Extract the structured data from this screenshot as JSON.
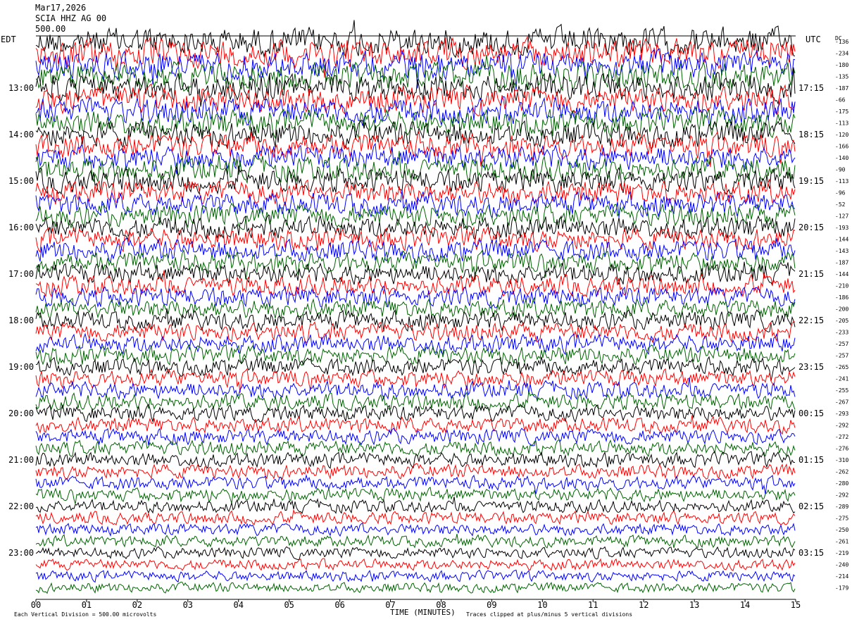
{
  "header": {
    "date": "Mar17,2026",
    "station": "SCIA HHZ AG 00",
    "scale": "500.00"
  },
  "left_zone_label": "EDT",
  "right_zone_label": "UTC",
  "dc_label": "DC",
  "footer": {
    "vertical_division": "Each Vertical Division =  500.00 microvolts",
    "xlabel": "TIME (MINUTES)",
    "clip_note": "Traces clipped at plus/minus 5 vertical divisions"
  },
  "chart_data": {
    "type": "line",
    "xlabel": "TIME (MINUTES)",
    "xlim": [
      0,
      15
    ],
    "x_ticks": [
      "00",
      "01",
      "02",
      "03",
      "04",
      "05",
      "06",
      "07",
      "08",
      "09",
      "10",
      "11",
      "12",
      "13",
      "14",
      "15"
    ],
    "left_hour_labels": [
      "13:00",
      "14:00",
      "15:00",
      "16:00",
      "17:00",
      "18:00",
      "19:00",
      "20:00",
      "21:00",
      "22:00",
      "23:00"
    ],
    "right_hour_labels": [
      "17:15",
      "18:15",
      "19:15",
      "20:15",
      "21:15",
      "22:15",
      "23:15",
      "00:15",
      "01:15",
      "02:15",
      "03:15"
    ],
    "trace_colors": [
      "#000000",
      "#ff0000",
      "#0000ff",
      "#006400"
    ],
    "dc_offsets": [
      -136,
      -234,
      -180,
      -135,
      -187,
      -66,
      -175,
      -113,
      -120,
      -166,
      -140,
      -90,
      -113,
      -96,
      -52,
      -127,
      -193,
      -144,
      -143,
      -187,
      -144,
      -210,
      -186,
      -200,
      -205,
      -233,
      -257,
      -257,
      -265,
      -241,
      -255,
      -267,
      -293,
      -292,
      -272,
      -276,
      -310,
      -262,
      -280,
      -292,
      -289,
      -275,
      -250,
      -261,
      -219,
      -240,
      -214,
      -179
    ]
  }
}
